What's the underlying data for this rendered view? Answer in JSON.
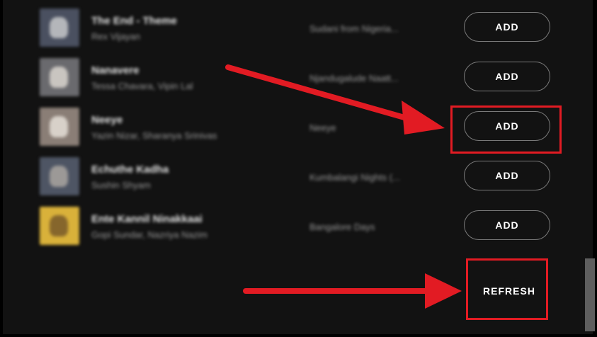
{
  "tracks": [
    {
      "title": "The End - Theme",
      "artist": "Rex Vijayan",
      "album": "Sudani from Nigeria...",
      "action": "ADD",
      "thumb_color": "#4a5060",
      "thumb_accent": "#d8d8d8"
    },
    {
      "title": "Nanavere",
      "artist": "Tessa Chavara, Vipin Lal",
      "album": "Njandugalude Naatt...",
      "action": "ADD",
      "thumb_color": "#6a6a6e",
      "thumb_accent": "#e9e4dc"
    },
    {
      "title": "Neeye",
      "artist": "Yazin Nizar, Sharanya Srinivas",
      "album": "Neeye",
      "action": "ADD",
      "thumb_color": "#8a7e76",
      "thumb_accent": "#f2ede6"
    },
    {
      "title": "Echuthe Kadha",
      "artist": "Sushin Shyam",
      "album": "Kumbalangi Nights (...",
      "action": "ADD",
      "thumb_color": "#4e5564",
      "thumb_accent": "#b7b0a8"
    },
    {
      "title": "Ente Kannil Ninakkaai",
      "artist": "Gopi Sundar, Nazriya Nazim",
      "album": "Bangalore Days",
      "action": "ADD",
      "thumb_color": "#d9b13a",
      "thumb_accent": "#6a4e28"
    }
  ],
  "refresh_label": "REFRESH",
  "colors": {
    "background": "#121212",
    "highlight": "#e21b23"
  }
}
